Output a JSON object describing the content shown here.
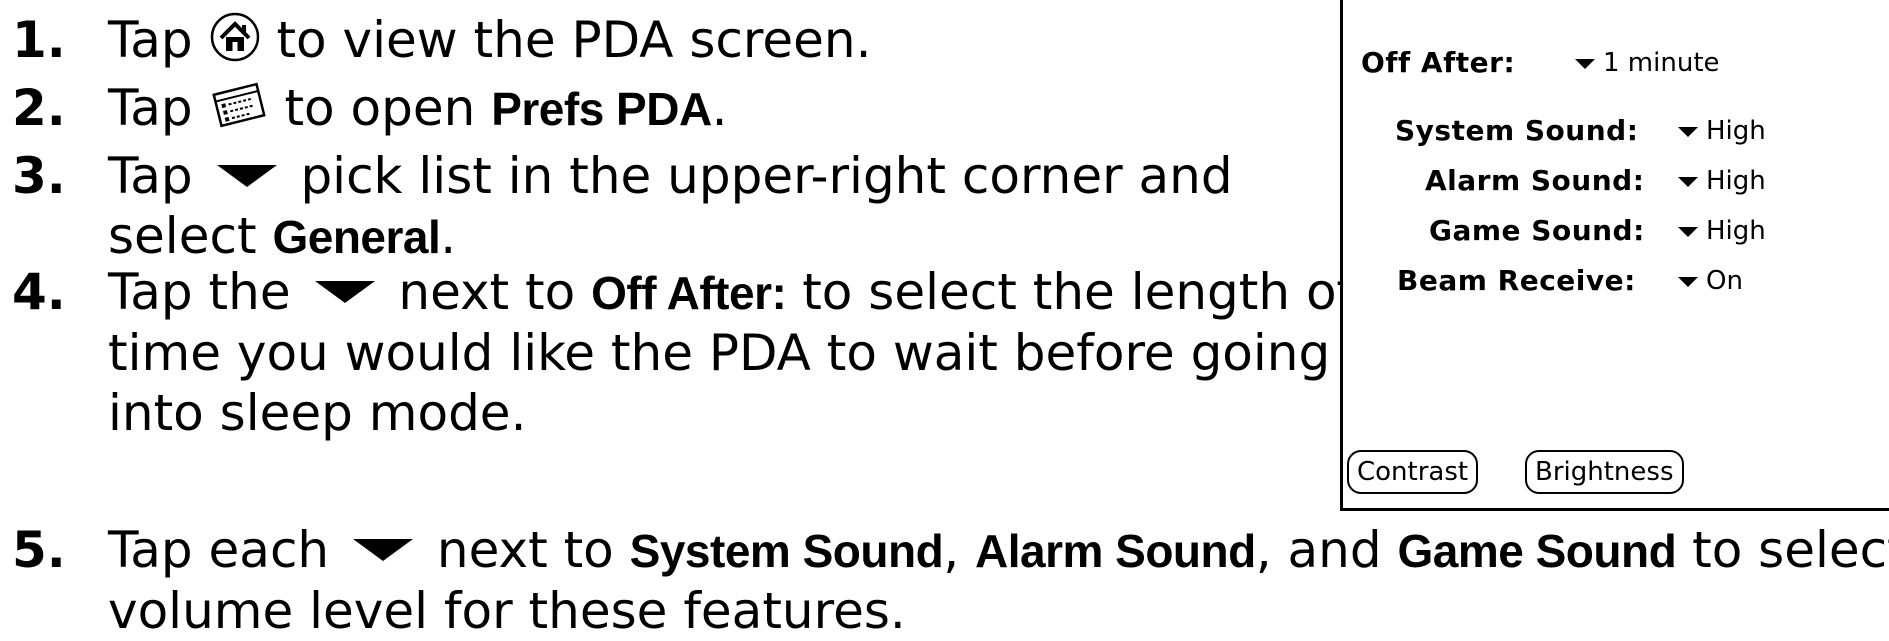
{
  "steps": [
    {
      "number": "1.",
      "lines": [
        [
          {
            "type": "text",
            "value": "Tap "
          },
          {
            "type": "icon",
            "icon": "home-icon"
          },
          {
            "type": "text",
            "value": " to view the PDA screen."
          }
        ]
      ]
    },
    {
      "number": "2.",
      "lines": [
        [
          {
            "type": "text",
            "value": "Tap "
          },
          {
            "type": "icon",
            "icon": "prefs-icon"
          },
          {
            "type": "text",
            "value": " to open "
          },
          {
            "type": "bold",
            "value": "Prefs PDA"
          },
          {
            "type": "text",
            "value": "."
          }
        ]
      ]
    },
    {
      "number": "3.",
      "lines": [
        [
          {
            "type": "text",
            "value": "Tap "
          },
          {
            "type": "icon",
            "icon": "down-triangle-icon"
          },
          {
            "type": "text",
            "value": " pick list in the upper-right corner and"
          }
        ],
        [
          {
            "type": "text",
            "value": "select "
          },
          {
            "type": "bold",
            "value": "General"
          },
          {
            "type": "text",
            "value": "."
          }
        ]
      ]
    },
    {
      "number": "4.",
      "lines": [
        [
          {
            "type": "text",
            "value": "Tap the "
          },
          {
            "type": "icon",
            "icon": "down-triangle-icon"
          },
          {
            "type": "text",
            "value": " next to "
          },
          {
            "type": "bold",
            "value": "Off After:"
          },
          {
            "type": "text",
            "value": " to select the length of"
          }
        ],
        [
          {
            "type": "text",
            "value": "time you would like the PDA to wait before going"
          }
        ],
        [
          {
            "type": "text",
            "value": "into sleep mode."
          }
        ]
      ]
    },
    {
      "number": "5.",
      "lines": [
        [
          {
            "type": "text",
            "value": "Tap each "
          },
          {
            "type": "icon",
            "icon": "down-triangle-icon"
          },
          {
            "type": "text",
            "value": " next to "
          },
          {
            "type": "bold",
            "value": "System Sound"
          },
          {
            "type": "text",
            "value": ", "
          },
          {
            "type": "bold",
            "value": "Alarm Sound"
          },
          {
            "type": "text",
            "value": ", and "
          },
          {
            "type": "bold",
            "value": "Game Sound"
          },
          {
            "type": "text",
            "value": " to select a"
          }
        ],
        [
          {
            "type": "text",
            "value": "volume level for these features."
          }
        ]
      ]
    }
  ],
  "pda_screen": {
    "settings": [
      {
        "label": "Off After:",
        "value": "1 minute"
      },
      {
        "label": "System Sound:",
        "value": "High"
      },
      {
        "label": "Alarm Sound:",
        "value": "High"
      },
      {
        "label": "Game Sound:",
        "value": "High"
      },
      {
        "label": "Beam Receive:",
        "value": "On"
      }
    ],
    "buttons": {
      "contrast": "Contrast",
      "brightness": "Brightness"
    }
  }
}
